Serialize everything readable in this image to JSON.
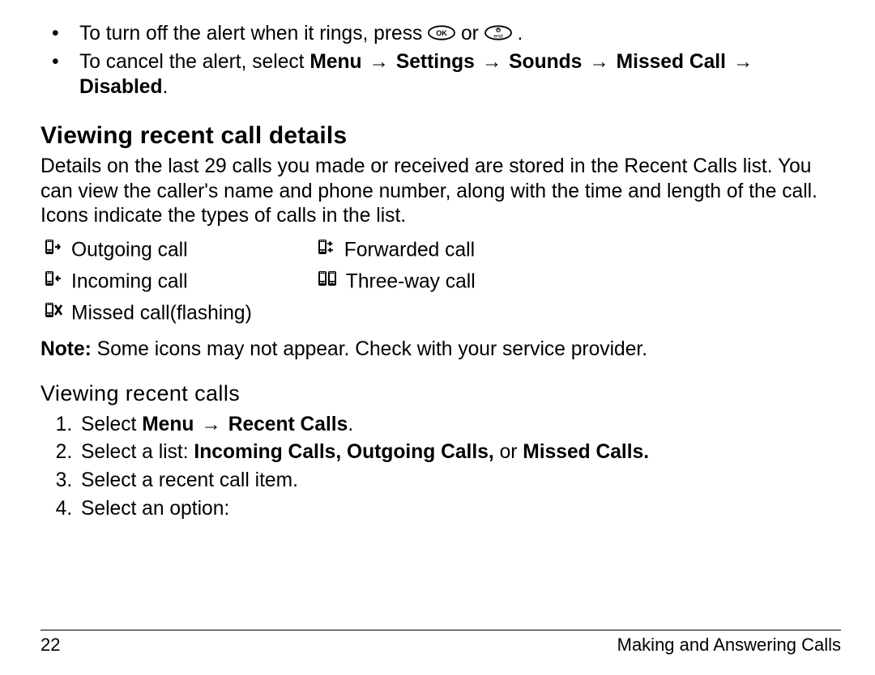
{
  "bullets": [
    {
      "prefix": "To turn off the alert when it rings, press ",
      "mid": " or ",
      "suffix": "."
    },
    {
      "prefix": "To cancel the alert, select ",
      "path": [
        "Menu",
        "Settings",
        "Sounds",
        "Missed Call",
        "Disabled"
      ],
      "suffix": "."
    }
  ],
  "arrow": "→",
  "section_heading": "Viewing recent call details",
  "section_body": "Details on the last 29 calls you made or received are stored in the Recent Calls list. You can view the caller's name and phone number, along with the time and length of the call. Icons indicate the types of calls in the list.",
  "call_icons": {
    "col1": [
      {
        "icon": "outgoing-call-icon",
        "label": "Outgoing call"
      },
      {
        "icon": "incoming-call-icon",
        "label": "Incoming call"
      },
      {
        "icon": "missed-call-icon",
        "label": "Missed call(flashing)"
      }
    ],
    "col2": [
      {
        "icon": "forwarded-call-icon",
        "label": "Forwarded call"
      },
      {
        "icon": "three-way-call-icon",
        "label": "Three-way call"
      }
    ]
  },
  "note_label": "Note:",
  "note_body": " Some icons may not appear. Check with your service provider.",
  "subsection_heading": "Viewing recent calls",
  "steps": [
    {
      "prefix": "Select ",
      "bold_path": [
        "Menu",
        "Recent Calls"
      ],
      "suffix": "."
    },
    {
      "prefix": "Select a list: ",
      "bold": "Incoming Calls, Outgoing Calls, ",
      "mid": "or ",
      "bold2": "Missed Calls.",
      "suffix": ""
    },
    {
      "text": "Select a recent call item."
    },
    {
      "text": "Select an option:"
    }
  ],
  "footer": {
    "page": "22",
    "title": "Making and Answering Calls"
  },
  "keys": {
    "ok": "OK",
    "end_symbol": "⦰",
    "end_label": "end"
  }
}
